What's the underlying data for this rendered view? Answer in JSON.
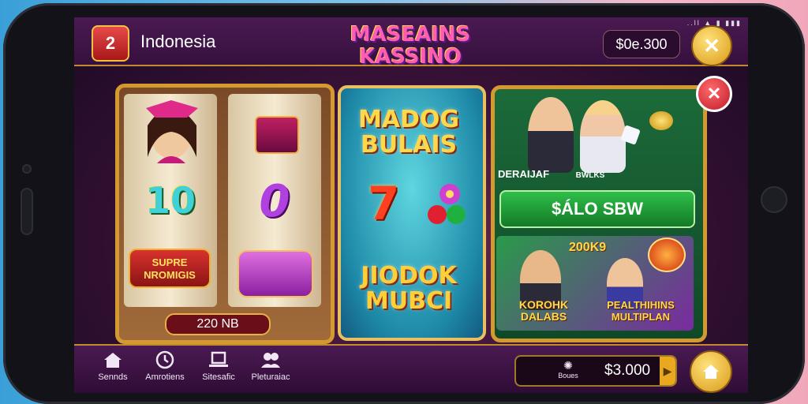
{
  "header": {
    "badge_number": "2",
    "country": "Indonesia",
    "brand_line1": "MASEAINS",
    "brand_line2": "KASSINO",
    "balance": "$0e.300",
    "status_text": "..ll ▲ ▮ ▮▮▮"
  },
  "panels": {
    "slots": {
      "reel_left_number": "10",
      "reel_right_symbol": "0",
      "banner_text": "SUPRE NROMIGIS",
      "footer": "220 NB"
    },
    "bonus": {
      "title_line1": "MADOG",
      "title_line2": "BULAIS",
      "lucky_number": "7",
      "jackpot_line1": "JIODOK",
      "jackpot_line2": "MUBCI"
    },
    "live": {
      "dealer_caption": "DERAIJAF",
      "dealer_caption2": "BWLKS",
      "play_button": "$ÁLO SBW",
      "amount_tag": "200K9",
      "left_caption_line1": "KOROHK",
      "left_caption_line2": "DALABS",
      "right_caption_line1": "PEALTHIHINS",
      "right_caption_line2": "MULTIPLAN"
    }
  },
  "navbar": {
    "items": [
      {
        "label": "Sennds",
        "icon": "home-icon"
      },
      {
        "label": "Amrotiens",
        "icon": "clock-icon"
      },
      {
        "label": "Sitesafic",
        "icon": "laptop-icon"
      },
      {
        "label": "Pleturaiac",
        "icon": "people-icon"
      }
    ],
    "bonus_label": "Boues",
    "balance": "$3.000"
  },
  "colors": {
    "gold": "#d99a18",
    "panel_purple": "#3a1238",
    "play_green": "#2fbf4a",
    "close_red": "#c01a2a"
  }
}
